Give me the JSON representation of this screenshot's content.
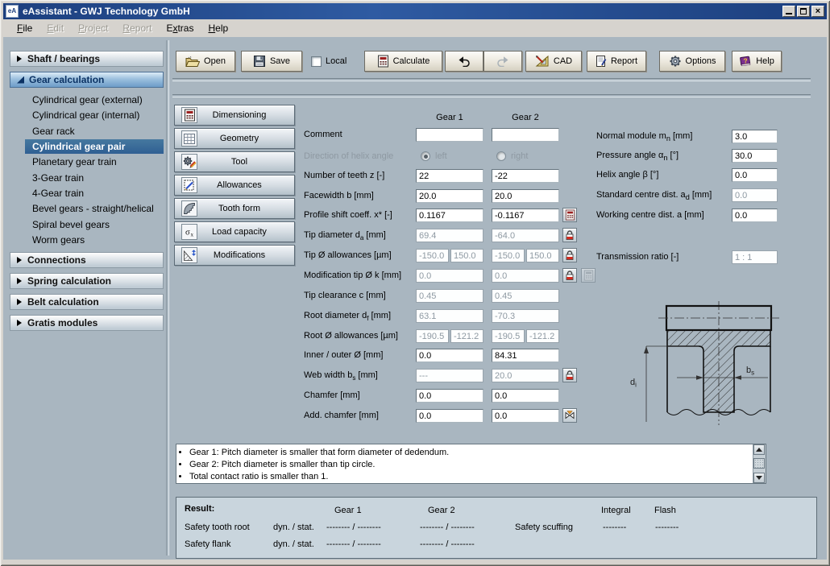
{
  "window": {
    "title": "eAssistant - GWJ Technology GmbH",
    "icon_text": "eA"
  },
  "menu": {
    "items": [
      {
        "pre": "",
        "key": "F",
        "post": "ile",
        "enabled": true
      },
      {
        "pre": "",
        "key": "E",
        "post": "dit",
        "enabled": false
      },
      {
        "pre": "",
        "key": "P",
        "post": "roject",
        "enabled": false
      },
      {
        "pre": "",
        "key": "R",
        "post": "eport",
        "enabled": false
      },
      {
        "pre": "E",
        "key": "x",
        "post": "tras",
        "enabled": true
      },
      {
        "pre": "",
        "key": "H",
        "post": "elp",
        "enabled": true
      }
    ]
  },
  "sidebar": {
    "sections": [
      {
        "label": "Shaft / bearings",
        "expanded": false
      },
      {
        "label": "Gear calculation",
        "expanded": true,
        "items": [
          "Cylindrical gear (external)",
          "Cylindrical gear (internal)",
          "Gear rack",
          "Cylindrical gear pair",
          "Planetary gear train",
          "3-Gear train",
          "4-Gear train",
          "Bevel gears - straight/helical",
          "Spiral bevel gears",
          "Worm gears"
        ],
        "selected_item": "Cylindrical gear pair"
      },
      {
        "label": "Connections",
        "expanded": false
      },
      {
        "label": "Spring calculation",
        "expanded": false
      },
      {
        "label": "Belt calculation",
        "expanded": false
      },
      {
        "label": "Gratis modules",
        "expanded": false
      }
    ]
  },
  "toolbar": {
    "open": "Open",
    "save": "Save",
    "local_label": "Local",
    "calculate": "Calculate",
    "cad": "CAD",
    "report": "Report",
    "options": "Options",
    "help": "Help"
  },
  "section_buttons": [
    "Dimensioning",
    "Geometry",
    "Tool",
    "Allowances",
    "Tooth form",
    "Load capacity",
    "Modifications"
  ],
  "form": {
    "gear1_header": "Gear 1",
    "gear2_header": "Gear 2",
    "rows": [
      {
        "label": "Comment",
        "gear1": "",
        "gear2": ""
      },
      {
        "label": "Direction of helix angle",
        "left_label": "left",
        "right_label": "right"
      },
      {
        "label": "Number of teeth z [-]",
        "gear1": "22",
        "gear2": "-22"
      },
      {
        "label": "Facewidth b [mm]",
        "gear1": "20.0",
        "gear2": "20.0"
      },
      {
        "label": "Profile shift coeff. x* [-]",
        "gear1": "0.1167",
        "gear2": "-0.1167"
      },
      {
        "label_pre": "Tip diameter d",
        "label_sub": "a",
        "label_post": " [mm]",
        "gear1": "69.4",
        "gear2": "-64.0"
      },
      {
        "label": "Tip Ø allowances [µm]",
        "gear1_upper": "-150.0",
        "gear1_lower": "150.0",
        "gear2_upper": "-150.0",
        "gear2_lower": "150.0"
      },
      {
        "label": "Modification tip Ø k [mm]",
        "gear1": "0.0",
        "gear2": "0.0"
      },
      {
        "label": "Tip clearance c [mm]",
        "gear1": "0.45",
        "gear2": "0.45"
      },
      {
        "label_pre": "Root diameter d",
        "label_sub": "f",
        "label_post": " [mm]",
        "gear1": "63.1",
        "gear2": "-70.3"
      },
      {
        "label": "Root Ø allowances [µm]",
        "gear1_upper": "-190.5",
        "gear1_lower": "-121.2",
        "gear2_upper": "-190.5",
        "gear2_lower": "-121.2"
      },
      {
        "label": "Inner / outer Ø [mm]",
        "gear1": "0.0",
        "gear2": "84.31"
      },
      {
        "label_pre": "Web width b",
        "label_sub": "s",
        "label_post": " [mm]",
        "gear1": "---",
        "gear2": "20.0"
      },
      {
        "label": "Chamfer [mm]",
        "gear1": "0.0",
        "gear2": "0.0"
      },
      {
        "label": "Add. chamfer [mm]",
        "gear1": "0.0",
        "gear2": "0.0"
      }
    ]
  },
  "right_form": {
    "rows": [
      {
        "label_pre": "Normal module m",
        "label_sub": "n",
        "label_post": " [mm]",
        "value": "3.0"
      },
      {
        "label_pre": "Pressure angle α",
        "label_sub": "n",
        "label_post": " [°]",
        "value": "30.0"
      },
      {
        "label": "Helix angle β [°]",
        "value": "0.0"
      },
      {
        "label_pre": "Standard centre dist. a",
        "label_sub": "d",
        "label_post": " [mm]",
        "value": "0.0"
      },
      {
        "label": "Working centre dist. a [mm]",
        "value": "0.0"
      },
      {
        "label": "Transmission ratio [-]",
        "value": "1 : 1"
      }
    ]
  },
  "diagram": {
    "di_pre": "d",
    "di_sub": "i",
    "bs_pre": "b",
    "bs_sub": "s"
  },
  "messages": [
    "Gear 1: Pitch diameter is smaller that form diameter of dedendum.",
    "Gear 2: Pitch diameter is smaller than tip circle.",
    "Total contact ratio is smaller than 1."
  ],
  "result": {
    "title": "Result:",
    "gear1": "Gear 1",
    "gear2": "Gear 2",
    "integral": "Integral",
    "flash": "Flash",
    "scuffing_label": "Safety scuffing",
    "scuffing_integral": "--------",
    "scuffing_flash": "--------",
    "rows": [
      {
        "label": "Safety tooth root",
        "mode": "dyn. / stat.",
        "gear1": "-------- / --------",
        "gear2": "-------- / --------"
      },
      {
        "label": "Safety flank",
        "mode": "dyn. / stat.",
        "gear1": "-------- / --------",
        "gear2": "-------- / --------"
      }
    ]
  }
}
